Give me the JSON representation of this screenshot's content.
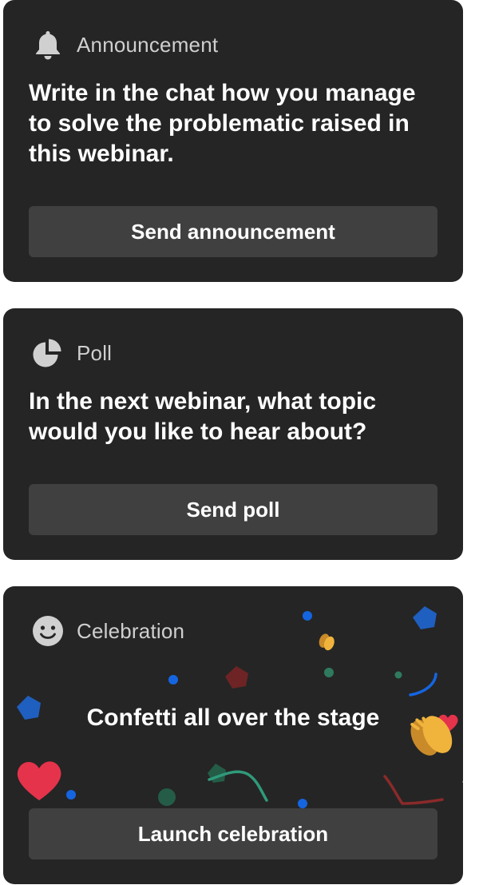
{
  "cards": {
    "announcement": {
      "type_label": "Announcement",
      "icon": "bell-icon",
      "message": "Write in the chat how you manage to solve the problematic raised in this webinar.",
      "button_label": "Send announcement"
    },
    "poll": {
      "type_label": "Poll",
      "icon": "pie-chart-icon",
      "message": "In the next webinar, what topic would you like to hear about?",
      "button_label": "Send poll"
    },
    "celebration": {
      "type_label": "Celebration",
      "icon": "smiley-icon",
      "message": "Confetti all over the stage",
      "button_label": "Launch celebration"
    }
  },
  "colors": {
    "card_background": "#252525",
    "button_background": "#404040",
    "type_label": "#cfcfcf",
    "confetti_blue": "#1565e0",
    "confetti_green": "#2f7a5f",
    "confetti_red": "#8a2a2a",
    "confetti_heart": "#e5334b",
    "clap_hand": "#f0b43c"
  }
}
